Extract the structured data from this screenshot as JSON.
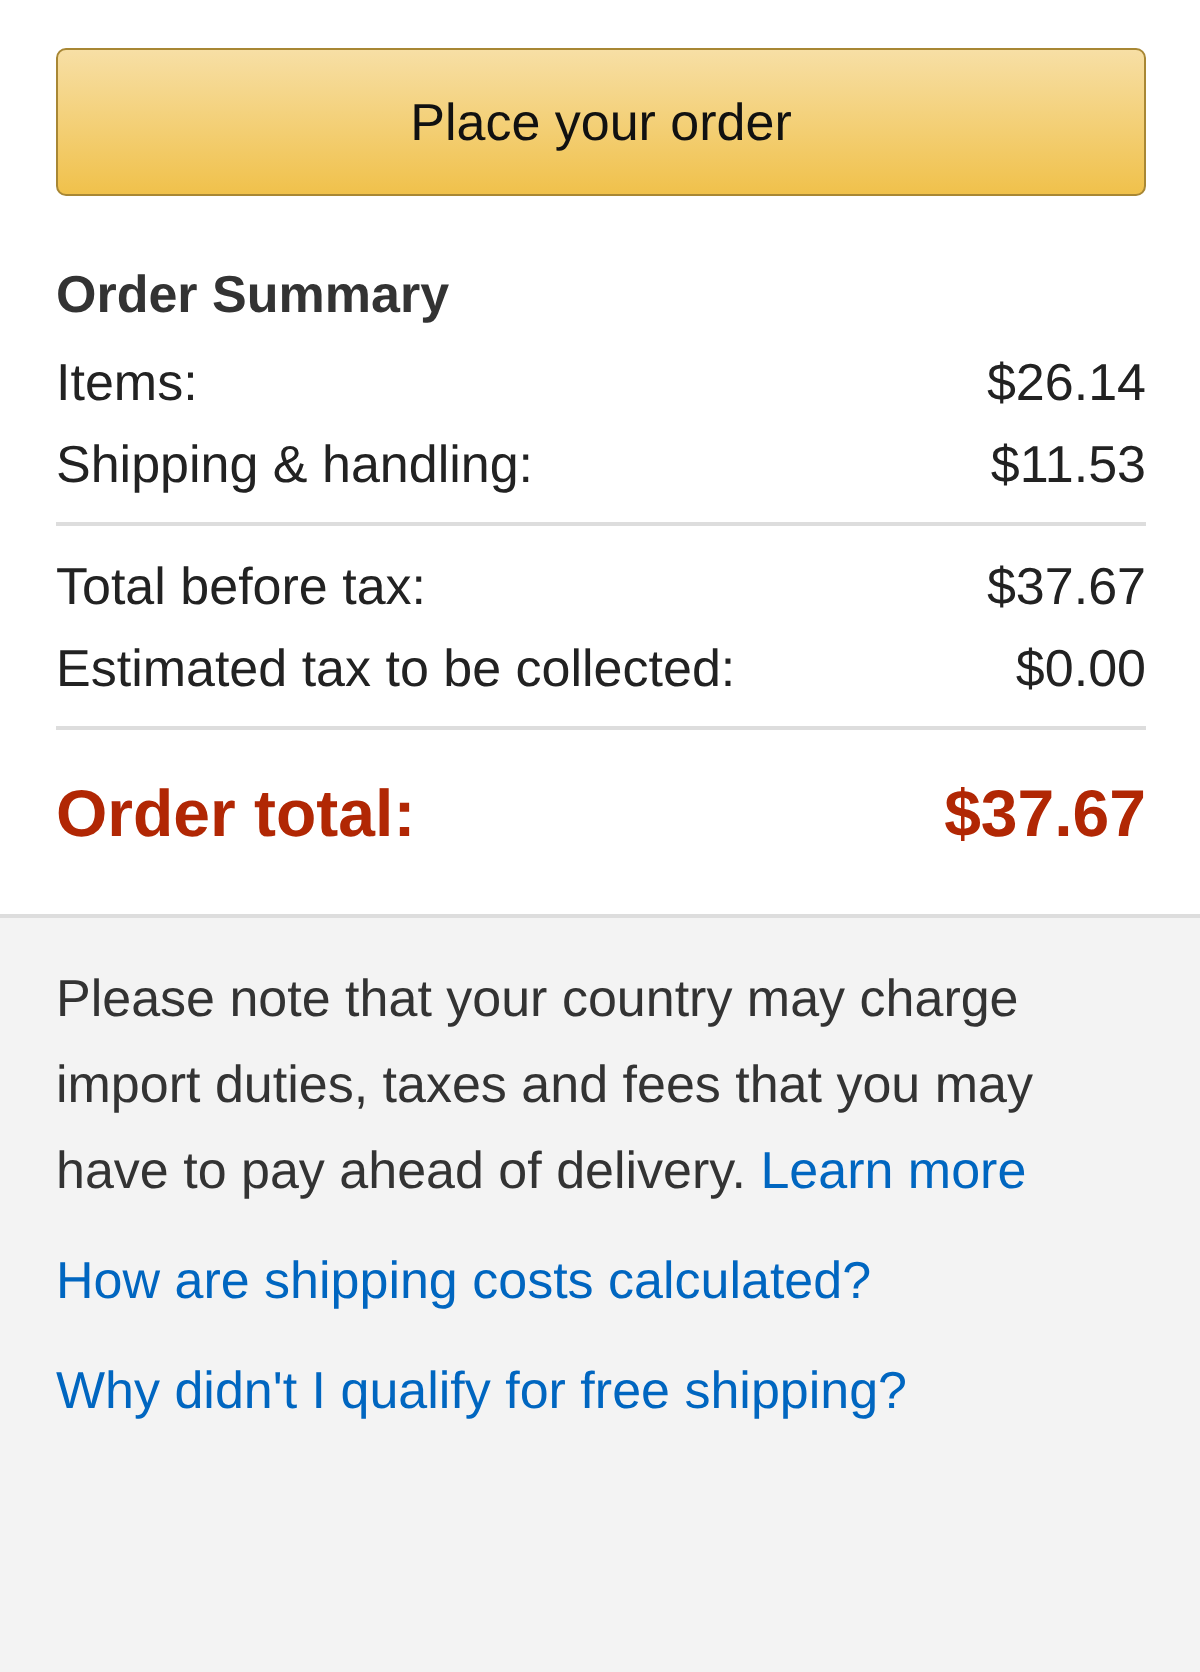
{
  "button": {
    "label": "Place your order"
  },
  "summary": {
    "title": "Order Summary",
    "groups": [
      [
        {
          "label": "Items:",
          "value": "$26.14"
        },
        {
          "label": "Shipping & handling:",
          "value": "$11.53"
        }
      ],
      [
        {
          "label": "Total before tax:",
          "value": "$37.67"
        },
        {
          "label": "Estimated tax to be collected:",
          "value": "$0.00"
        }
      ]
    ],
    "total": {
      "label": "Order total:",
      "value": "$37.67"
    }
  },
  "note": {
    "text": "Please note that your country may charge import duties, taxes and fees that you may have to pay ahead of delivery.",
    "link": "Learn more"
  },
  "links": [
    "How are shipping costs calculated?",
    "Why didn't I qualify for free shipping?"
  ]
}
